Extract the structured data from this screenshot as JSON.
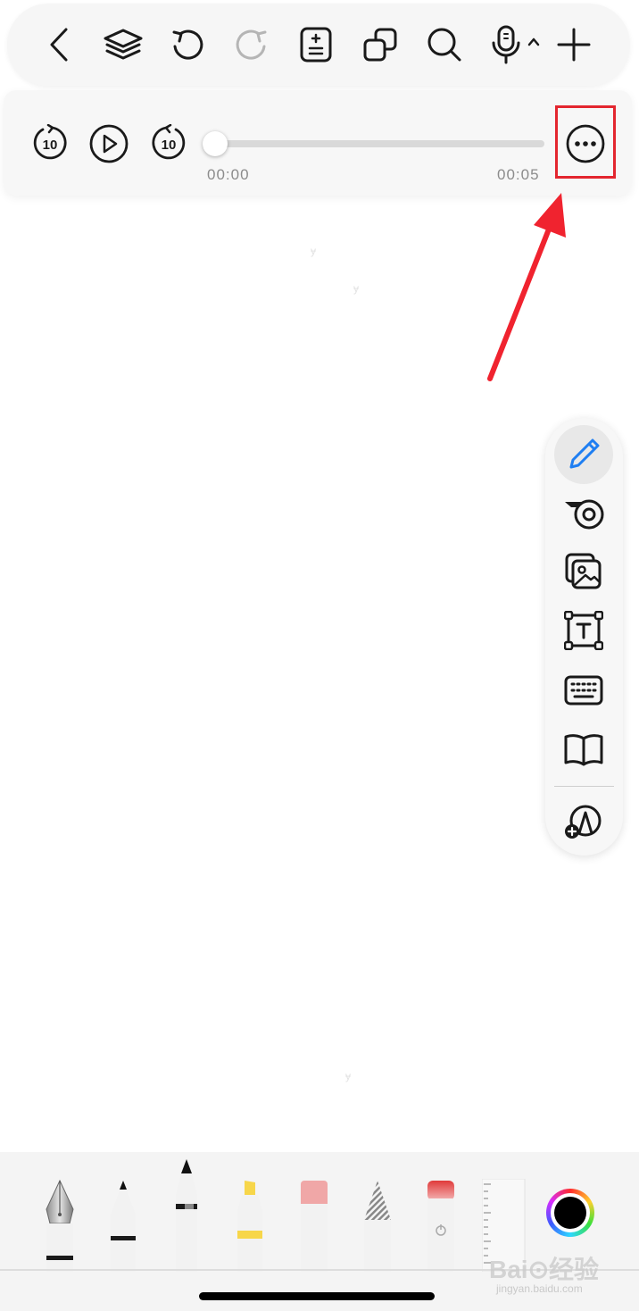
{
  "top_toolbar": {
    "buttons": [
      "chevron-left-icon",
      "layers-icon",
      "undo-icon",
      "redo-icon",
      "page-insert-icon",
      "duplicate-pages-icon",
      "search-icon",
      "microphone-icon",
      "add-icon"
    ]
  },
  "audio_player": {
    "elapsed": "00:00",
    "duration": "00:05",
    "progress_fraction": 0,
    "skip_back_label": "10",
    "skip_forward_label": "10"
  },
  "annotation": {
    "highlight_color": "#e3262f",
    "arrow_color": "#f0232f"
  },
  "side_toolbar": {
    "tools": [
      "pen-tool-icon",
      "lasso-tape-icon",
      "image-icon",
      "text-box-icon",
      "keyboard-icon",
      "reader-icon",
      "add-custom-tool-icon"
    ],
    "active": "pen-tool-icon",
    "active_color": "#1e7ef2"
  },
  "pen_tray": {
    "tools": [
      "fountain-pen",
      "ballpoint-pen",
      "fineliner-pen",
      "highlighter",
      "eraser",
      "pencil",
      "smart-eraser",
      "ruler"
    ],
    "current_color": "#000000"
  },
  "watermark": {
    "text": "Bai⊙经验",
    "url_text": "jingyan.baidu.com"
  }
}
